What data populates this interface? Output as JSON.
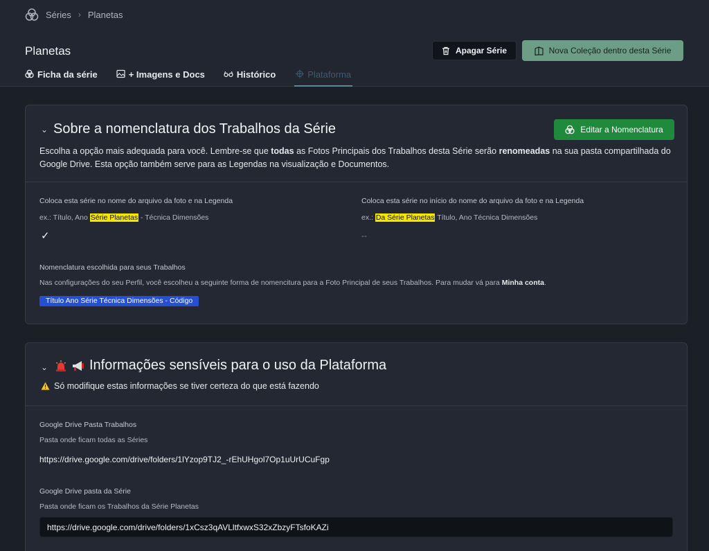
{
  "breadcrumb": {
    "root": "Séries",
    "current": "Planetas"
  },
  "header": {
    "title": "Planetas",
    "delete_label": "Apagar Série",
    "new_collection_label": "Nova Coleção dentro desta Série"
  },
  "tabs": [
    {
      "label": "Ficha da série"
    },
    {
      "label": "+ Imagens e Docs"
    },
    {
      "label": "Histórico"
    },
    {
      "label": "Plataforma"
    }
  ],
  "nomenclature": {
    "title": "Sobre a nomenclatura dos Trabalhos da Série",
    "edit_label": "Editar a Nomenclatura",
    "desc_1": "Escolha a opção mais adequada para você. Lembre-se que ",
    "desc_bold_1": "todas",
    "desc_2": " as Fotos Principais dos Trabalhos desta Série serão ",
    "desc_bold_2": "renomeadas",
    "desc_3": " na sua pasta compartilhada do Google Drive. Esta opção também serve para as Legendas na visualização e Documentos.",
    "option_a": {
      "label": "Coloca esta série no nome do arquivo da foto e na Legenda",
      "ex_prefix": "ex.: Título, Ano ",
      "ex_highlight": "Série Planetas",
      "ex_suffix": " - Técnica Dimensões",
      "state": "✓"
    },
    "option_b": {
      "label": "Coloca esta série no início do nome do arquivo da foto e na Legenda",
      "ex_prefix": "ex.: ",
      "ex_highlight": "Da Série Planetas",
      "ex_suffix": " Título, Ano Técnica Dimensões",
      "state": "--"
    },
    "chosen_label": "Nomenclatura escolhida para seus Trabalhos",
    "chosen_desc": "Nas configurações do seu Perfil, você escolheu a seguinte forma de nomencitura para a Foto Principal de seus Trabalhos. Para mudar vá para ",
    "chosen_link": "Minha conta",
    "chosen_end": ".",
    "chosen_badge": "Título Ano Série Técnica Dimensões - Código"
  },
  "sensitive": {
    "title": "Informações sensíveis para o uso da Plataforma",
    "warning": "Só modifique estas informações se tiver certeza do que está fazendo",
    "drive_works_label": "Google Drive Pasta Trabalhos",
    "drive_works_sub": "Pasta onde ficam todas as Séries",
    "drive_works_url": "https://drive.google.com/drive/folders/1lYzop9TJ2_-rEhUHgol7Op1uUrUCuFgp",
    "drive_series_label": "Google Drive pasta da Série",
    "drive_series_sub": "Pasta onde ficam os Trabalhos da Série Planetas",
    "drive_series_url": "https://drive.google.com/drive/folders/1xCsz3qAVLltfxwxS32xZbzyFTsfoKAZi"
  },
  "colors": {
    "accent_green": "#1f8a3c",
    "muted_green": "#6e9d86",
    "badge_blue": "#2550d4",
    "highlight": "#f5e600"
  }
}
